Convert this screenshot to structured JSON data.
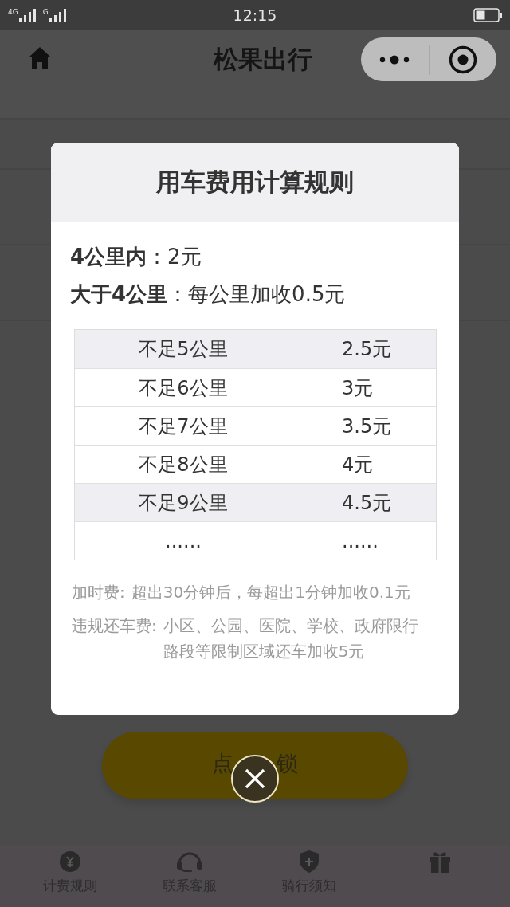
{
  "status_bar": {
    "network_1": "4G",
    "network_2": "G",
    "time": "12:15"
  },
  "nav_bar": {
    "title": "松果出行"
  },
  "main": {
    "unlock_button": {
      "text_left": "点",
      "text_right": "锁"
    }
  },
  "tab_bar": {
    "tabs": [
      {
        "label": "计费规则"
      },
      {
        "label": "联系客服"
      },
      {
        "label": "骑行须知"
      }
    ]
  },
  "dialog": {
    "title": "用车费用计算规则",
    "rules": [
      "**4公里内**：2元",
      "**大于4公里**：每公里加收0.5元"
    ],
    "table": {
      "rows": [
        {
          "cells": [
            "不足5公里",
            "2.5元"
          ],
          "shaded": true
        },
        {
          "cells": [
            "不足6公里",
            "3元"
          ],
          "shaded": false
        },
        {
          "cells": [
            "不足7公里",
            "3.5元"
          ],
          "shaded": false
        },
        {
          "cells": [
            "不足8公里",
            "4元"
          ],
          "shaded": false
        },
        {
          "cells": [
            "不足9公里",
            "4.5元"
          ],
          "shaded": true
        },
        {
          "cells": [
            "......",
            "......"
          ],
          "shaded": false
        }
      ]
    },
    "notes": [
      {
        "label": "加时费:",
        "text": "超出30分钟后，每超出1分钟加收0.1元"
      },
      {
        "label": "违规还车费:",
        "text": "小区、公园、医院、学校、政府限行路段等限制区域还车加收5元"
      }
    ]
  }
}
